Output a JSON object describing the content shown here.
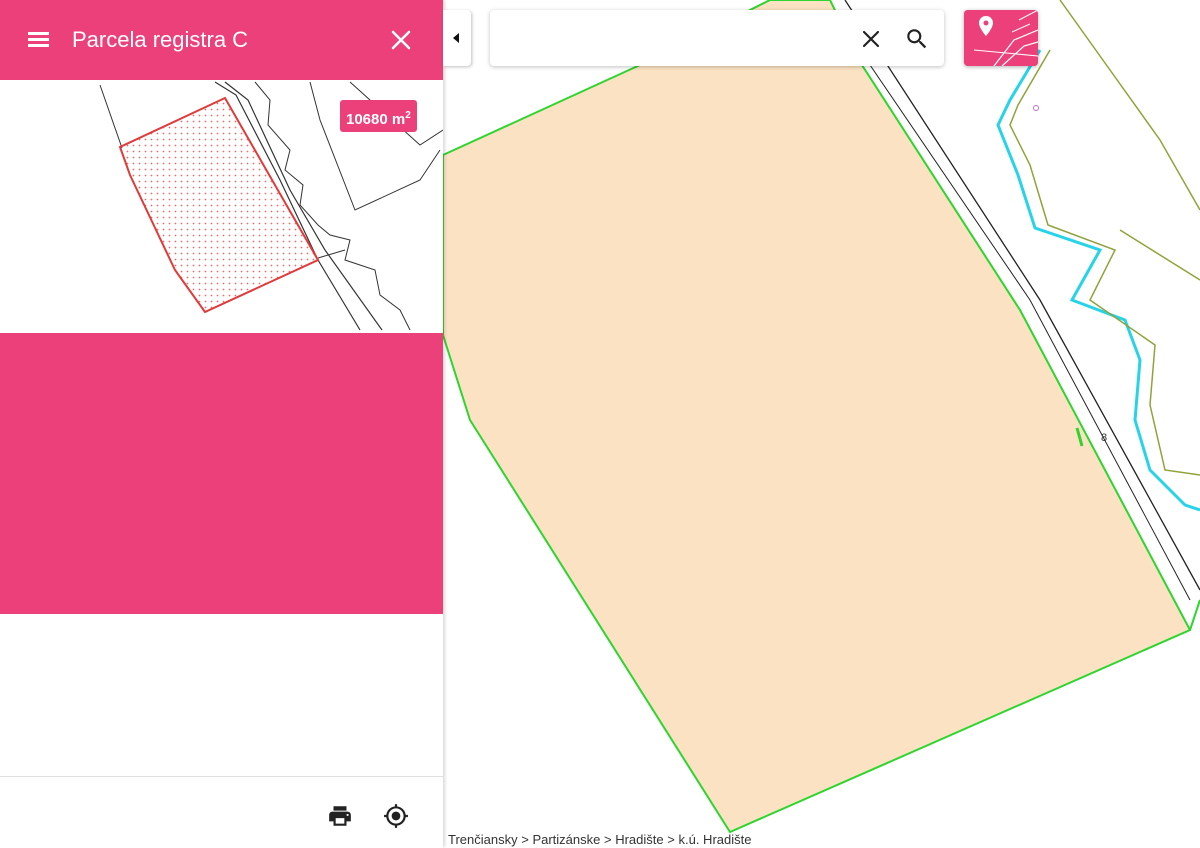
{
  "panel": {
    "title": "Parcela registra C",
    "area_value": "10680 m",
    "area_unit_sup": "2"
  },
  "search": {
    "value": "",
    "placeholder": ""
  },
  "map": {
    "label_8": "8",
    "breadcrumb": [
      "Trenčiansky",
      "Partizánske",
      "Hradište",
      "k.ú. Hradište"
    ],
    "breadcrumb_separator": ">"
  },
  "colors": {
    "accent": "#ec407a",
    "parcel_fill": "#fbe2c2",
    "parcel_border": "#2ed52e",
    "stream": "#27d3e8",
    "contour": "#8fa33a"
  },
  "icons": {
    "menu": "menu-icon",
    "close": "close-icon",
    "collapse": "chevron-left-icon",
    "clear": "clear-icon",
    "search": "search-icon",
    "layers": "map-layer-icon",
    "print": "print-icon",
    "locate": "gps-locate-icon"
  }
}
